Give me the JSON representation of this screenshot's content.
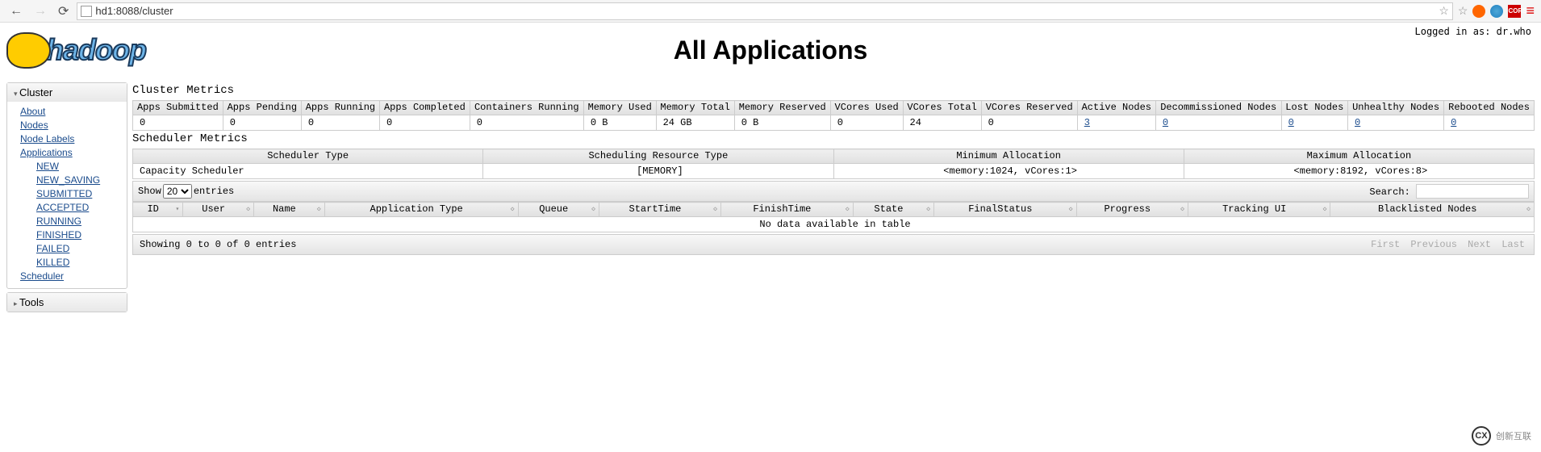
{
  "browser": {
    "url": "hd1:8088/cluster",
    "cors_label": "CORS"
  },
  "login_text": "Logged in as: dr.who",
  "logo_text": "hadoop",
  "page_title": "All Applications",
  "sidebar": {
    "cluster_header": "Cluster",
    "tools_header": "Tools",
    "links": {
      "about": "About",
      "nodes": "Nodes",
      "node_labels": "Node Labels",
      "applications": "Applications",
      "scheduler": "Scheduler"
    },
    "app_states": {
      "new": "NEW",
      "new_saving": "NEW_SAVING",
      "submitted": "SUBMITTED",
      "accepted": "ACCEPTED",
      "running": "RUNNING",
      "finished": "FINISHED",
      "failed": "FAILED",
      "killed": "KILLED"
    }
  },
  "cluster_metrics": {
    "title": "Cluster Metrics",
    "headers": {
      "apps_submitted": "Apps Submitted",
      "apps_pending": "Apps Pending",
      "apps_running": "Apps Running",
      "apps_completed": "Apps Completed",
      "containers_running": "Containers Running",
      "memory_used": "Memory Used",
      "memory_total": "Memory Total",
      "memory_reserved": "Memory Reserved",
      "vcores_used": "VCores Used",
      "vcores_total": "VCores Total",
      "vcores_reserved": "VCores Reserved",
      "active_nodes": "Active Nodes",
      "decommissioned_nodes": "Decommissioned Nodes",
      "lost_nodes": "Lost Nodes",
      "unhealthy_nodes": "Unhealthy Nodes",
      "rebooted_nodes": "Rebooted Nodes"
    },
    "values": {
      "apps_submitted": "0",
      "apps_pending": "0",
      "apps_running": "0",
      "apps_completed": "0",
      "containers_running": "0",
      "memory_used": "0 B",
      "memory_total": "24 GB",
      "memory_reserved": "0 B",
      "vcores_used": "0",
      "vcores_total": "24",
      "vcores_reserved": "0",
      "active_nodes": "3",
      "decommissioned_nodes": "0",
      "lost_nodes": "0",
      "unhealthy_nodes": "0",
      "rebooted_nodes": "0"
    }
  },
  "scheduler_metrics": {
    "title": "Scheduler Metrics",
    "headers": {
      "scheduler_type": "Scheduler Type",
      "resource_type": "Scheduling Resource Type",
      "min_alloc": "Minimum Allocation",
      "max_alloc": "Maximum Allocation"
    },
    "values": {
      "scheduler_type": "Capacity Scheduler",
      "resource_type": "[MEMORY]",
      "min_alloc": "<memory:1024, vCores:1>",
      "max_alloc": "<memory:8192, vCores:8>"
    }
  },
  "table_controls": {
    "show_label": "Show",
    "show_value": "20",
    "entries_label": "entries",
    "search_label": "Search:"
  },
  "app_headers": {
    "id": "ID",
    "user": "User",
    "name": "Name",
    "app_type": "Application Type",
    "queue": "Queue",
    "start": "StartTime",
    "finish": "FinishTime",
    "state": "State",
    "final_status": "FinalStatus",
    "progress": "Progress",
    "tracking": "Tracking UI",
    "blacklisted": "Blacklisted Nodes"
  },
  "no_data_text": "No data available in table",
  "footer": {
    "showing": "Showing 0 to 0 of 0 entries",
    "first": "First",
    "previous": "Previous",
    "next": "Next",
    "last": "Last"
  },
  "watermark": "创新互联"
}
